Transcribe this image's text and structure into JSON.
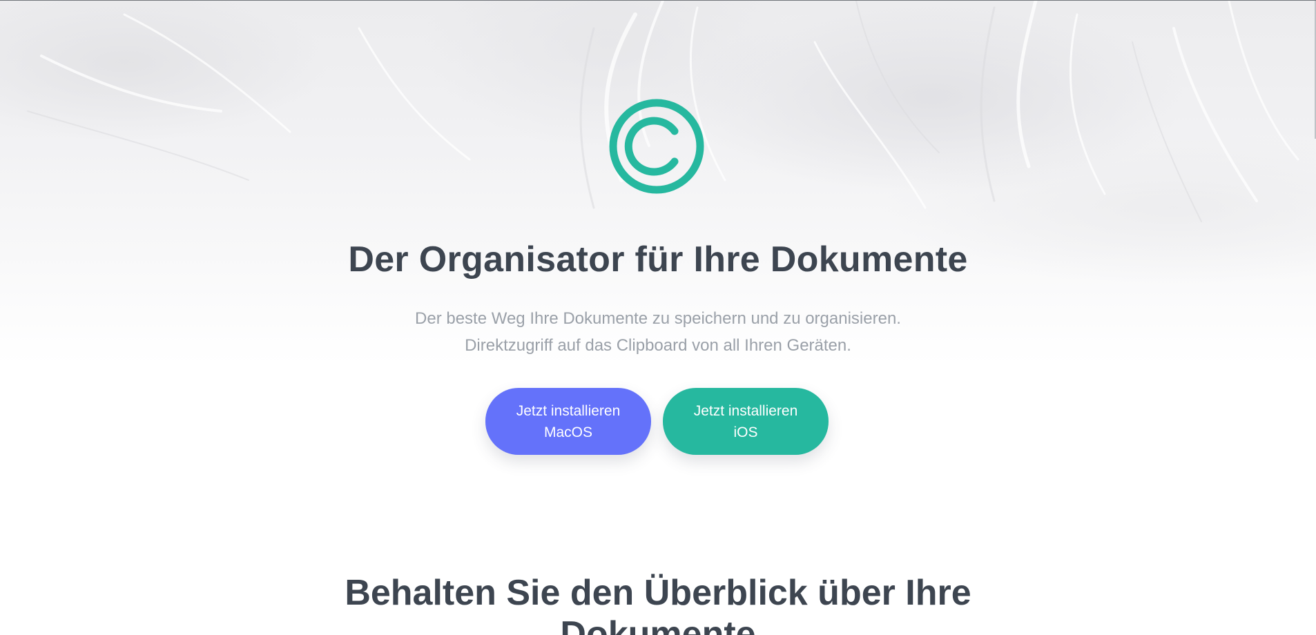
{
  "hero": {
    "logo_icon": "copyright-icon",
    "accent_color": "#26b89f",
    "title": "Der Organisator für Ihre Dokumente",
    "subtitle_line1": "Der beste Weg Ihre Dokumente zu speichern und zu organisieren.",
    "subtitle_line2": "Direktzugriff auf das Clipboard von all Ihren Geräten.",
    "buttons": [
      {
        "line1": "Jetzt installieren",
        "line2": "MacOS",
        "color": "#6472fa"
      },
      {
        "line1": "Jetzt installieren",
        "line2": "iOS",
        "color": "#26b89f"
      }
    ]
  },
  "section": {
    "title_line1": "Behalten Sie den Überblick über Ihre",
    "title_line2": "Dokumente"
  }
}
